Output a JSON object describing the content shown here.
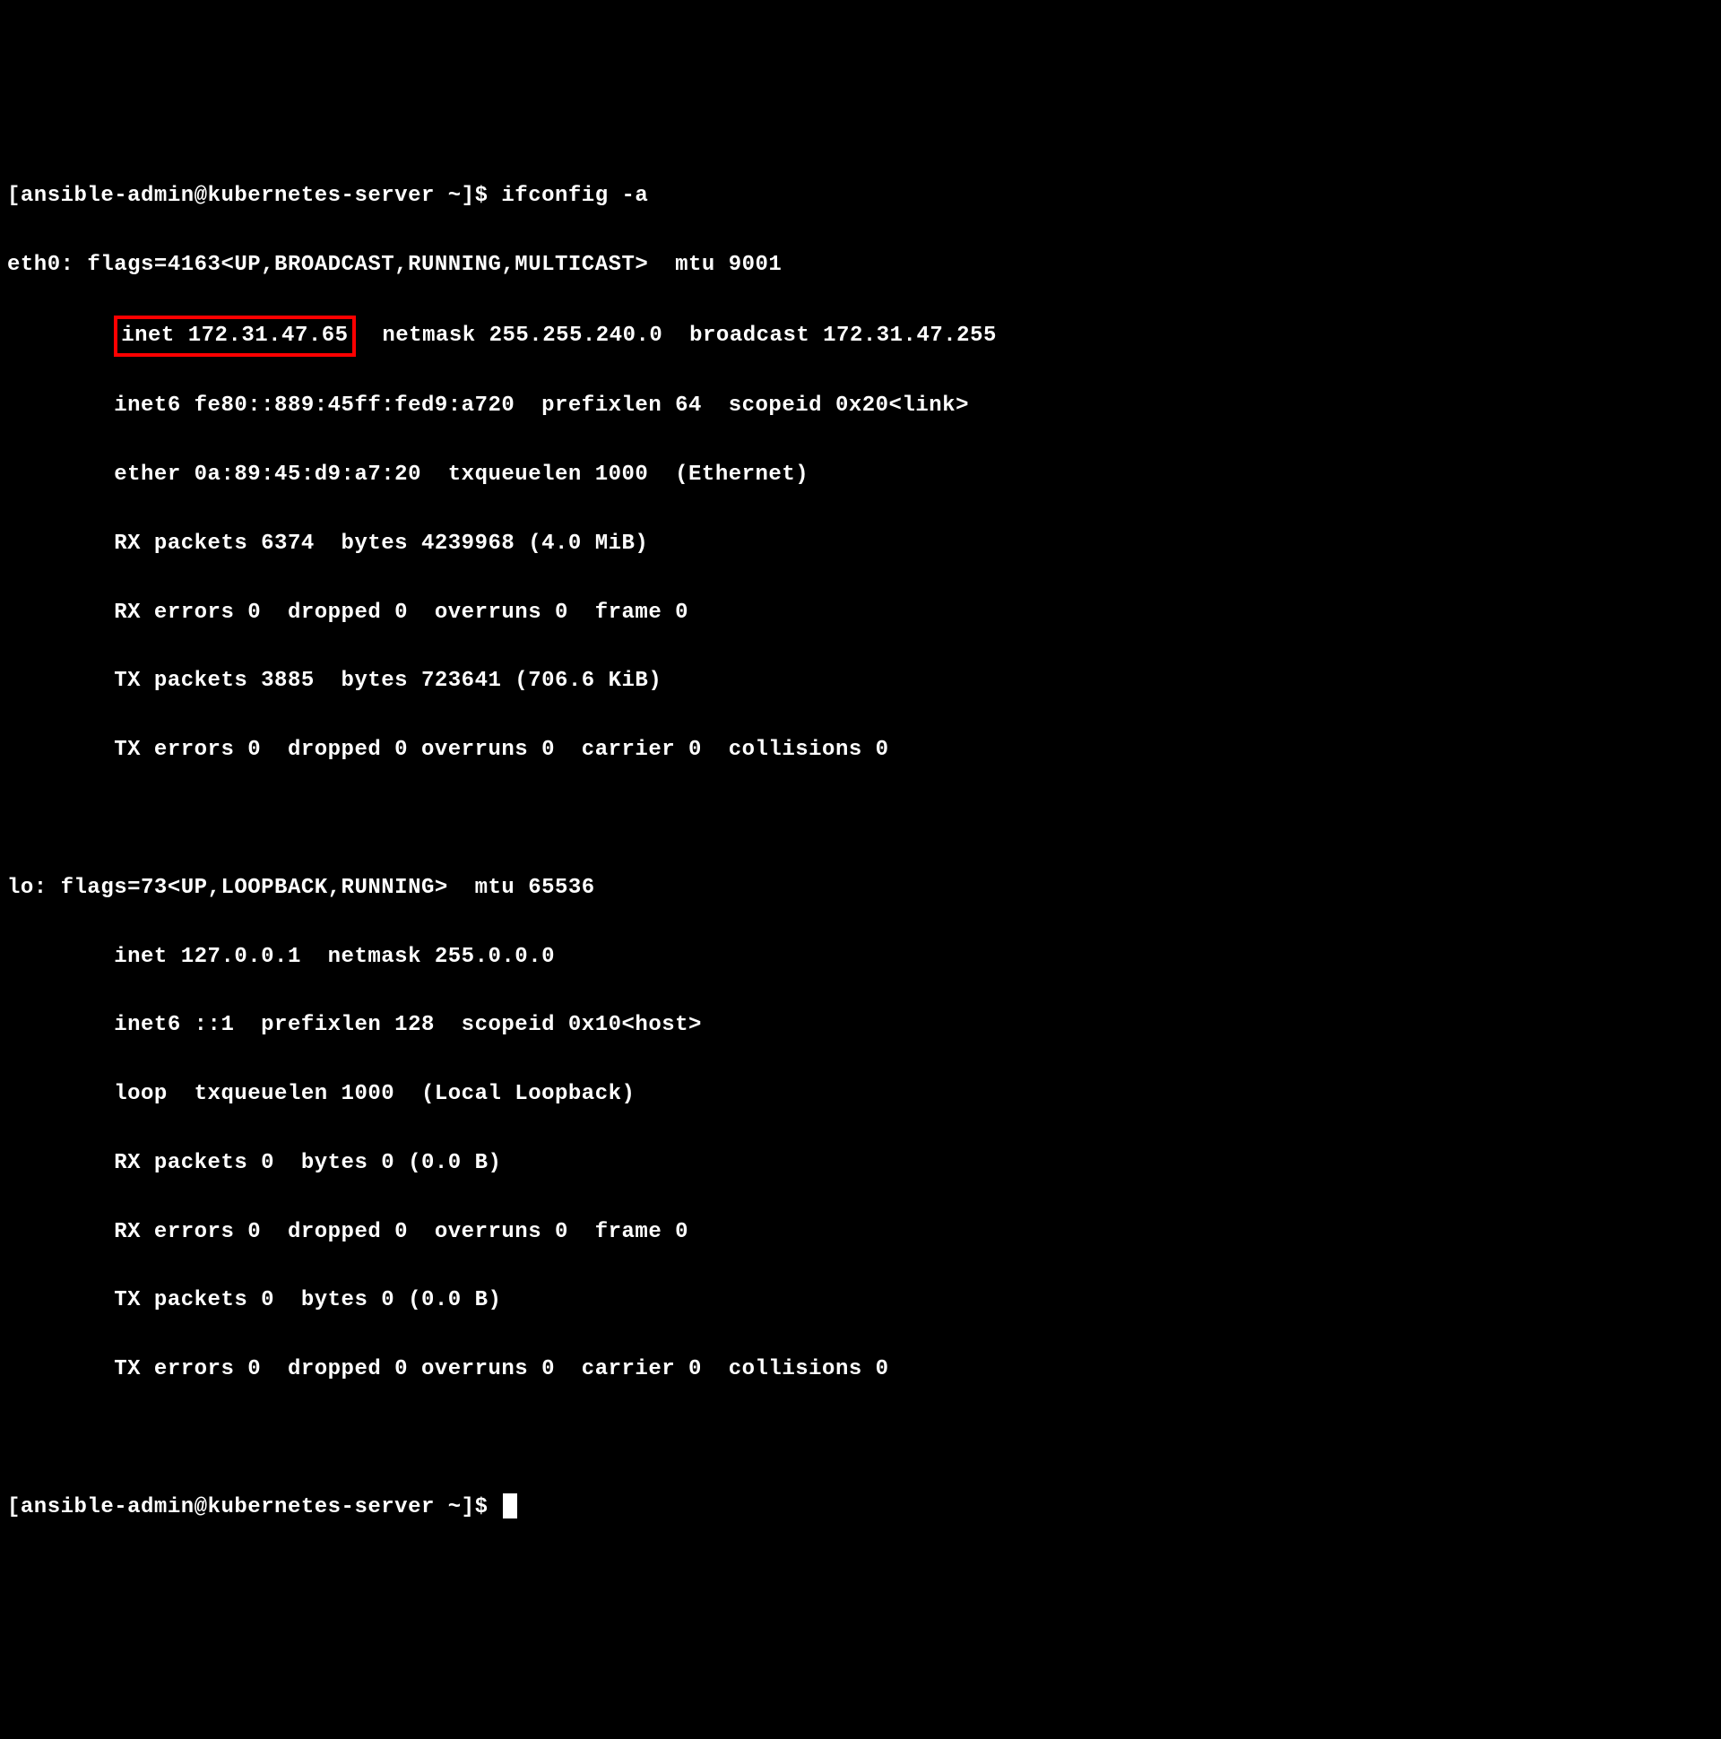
{
  "terminal": {
    "prompt1": "[ansible-admin@kubernetes-server ~]$ ",
    "command": "ifconfig -a",
    "eth0": {
      "header": "eth0: flags=4163<UP,BROADCAST,RUNNING,MULTICAST>  mtu 9001",
      "inet_label": "inet 172.31.47.65",
      "inet_rest": "  netmask 255.255.240.0  broadcast 172.31.47.255",
      "inet6": "        inet6 fe80::889:45ff:fed9:a720  prefixlen 64  scopeid 0x20<link>",
      "ether": "        ether 0a:89:45:d9:a7:20  txqueuelen 1000  (Ethernet)",
      "rx_packets": "        RX packets 6374  bytes 4239968 (4.0 MiB)",
      "rx_errors": "        RX errors 0  dropped 0  overruns 0  frame 0",
      "tx_packets": "        TX packets 3885  bytes 723641 (706.6 KiB)",
      "tx_errors": "        TX errors 0  dropped 0 overruns 0  carrier 0  collisions 0"
    },
    "lo": {
      "header": "lo: flags=73<UP,LOOPBACK,RUNNING>  mtu 65536",
      "inet": "        inet 127.0.0.1  netmask 255.0.0.0",
      "inet6": "        inet6 ::1  prefixlen 128  scopeid 0x10<host>",
      "loop": "        loop  txqueuelen 1000  (Local Loopback)",
      "rx_packets": "        RX packets 0  bytes 0 (0.0 B)",
      "rx_errors": "        RX errors 0  dropped 0  overruns 0  frame 0",
      "tx_packets": "        TX packets 0  bytes 0 (0.0 B)",
      "tx_errors": "        TX errors 0  dropped 0 overruns 0  carrier 0  collisions 0"
    },
    "prompt2": "[ansible-admin@kubernetes-server ~]$ ",
    "indent_prefix": "        "
  }
}
